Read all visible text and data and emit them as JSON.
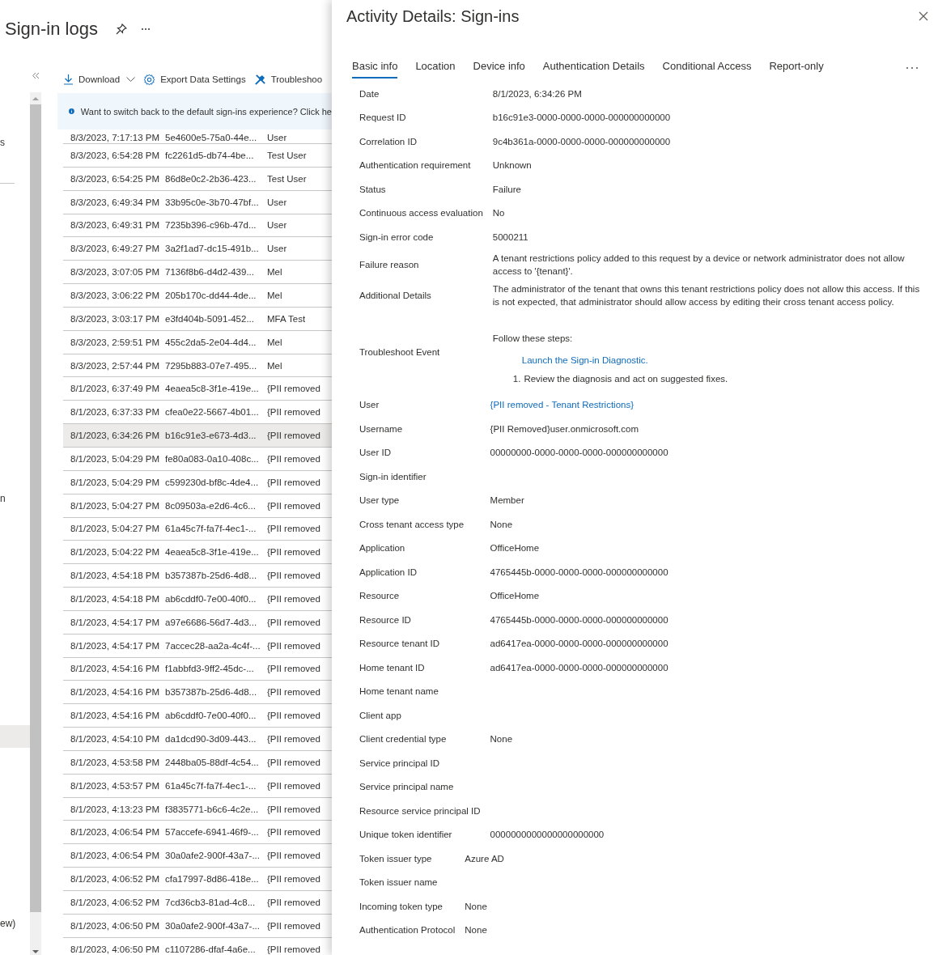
{
  "blade": {
    "title": "Sign-in logs"
  },
  "sidebar": {
    "items": [
      {
        "label": "s",
        "selected": false
      },
      {
        "label": "n",
        "selected": false
      },
      {
        "selected": true
      },
      {
        "label": "ew)",
        "selected": false
      }
    ]
  },
  "toolbar": [
    {
      "kind": "download",
      "label": "Download"
    },
    {
      "kind": "settings",
      "label": "Export Data Settings"
    },
    {
      "kind": "troubleshoot",
      "label": "Troubleshoo"
    }
  ],
  "banner": {
    "text": "Want to switch back to the default sign-ins experience? Click he"
  },
  "table": {
    "rows": [
      {
        "date": "8/3/2023, 7:17:13 PM",
        "request_id": "5e4600e5-75a0-44e...",
        "user": "User",
        "selected": false
      },
      {
        "date": "8/3/2023, 6:54:28 PM",
        "request_id": "fc2261d5-db74-4be...",
        "user": "Test User",
        "selected": false
      },
      {
        "date": "8/3/2023, 6:54:25 PM",
        "request_id": "86d8e0c2-2b36-423...",
        "user": "Test User",
        "selected": false
      },
      {
        "date": "8/3/2023, 6:49:34 PM",
        "request_id": "33b95c0e-3b70-47bf...",
        "user": "User",
        "selected": false
      },
      {
        "date": "8/3/2023, 6:49:31 PM",
        "request_id": "7235b396-c96b-47d...",
        "user": "User",
        "selected": false
      },
      {
        "date": "8/3/2023, 6:49:27 PM",
        "request_id": "3a2f1ad7-dc15-491b...",
        "user": "User",
        "selected": false
      },
      {
        "date": "8/3/2023, 3:07:05 PM",
        "request_id": "7136f8b6-d4d2-439...",
        "user": "Mel",
        "selected": false
      },
      {
        "date": "8/3/2023, 3:06:22 PM",
        "request_id": "205b170c-dd44-4de...",
        "user": "Mel",
        "selected": false
      },
      {
        "date": "8/3/2023, 3:03:17 PM",
        "request_id": "e3fd404b-5091-452...",
        "user": "MFA Test",
        "selected": false
      },
      {
        "date": "8/3/2023, 2:59:51 PM",
        "request_id": "455c2da5-2e04-4d4...",
        "user": "Mel",
        "selected": false
      },
      {
        "date": "8/3/2023, 2:57:44 PM",
        "request_id": "7295b883-07e7-495...",
        "user": "Mel",
        "selected": false
      },
      {
        "date": "8/1/2023, 6:37:49 PM",
        "request_id": "4eaea5c8-3f1e-419e...",
        "user": "{PII removed",
        "selected": false
      },
      {
        "date": "8/1/2023, 6:37:33 PM",
        "request_id": "cfea0e22-5667-4b01...",
        "user": "{PII removed",
        "selected": false
      },
      {
        "date": "8/1/2023, 6:34:26 PM",
        "request_id": "b16c91e3-e673-4d3...",
        "user": "{PII removed",
        "selected": true
      },
      {
        "date": "8/1/2023, 5:04:29 PM",
        "request_id": "fe80a083-0a10-408c...",
        "user": "{PII removed",
        "selected": false
      },
      {
        "date": "8/1/2023, 5:04:29 PM",
        "request_id": "c599230d-bf8c-4de4...",
        "user": "{PII removed",
        "selected": false
      },
      {
        "date": "8/1/2023, 5:04:27 PM",
        "request_id": "8c09503a-e2d6-4c6...",
        "user": "{PII removed",
        "selected": false
      },
      {
        "date": "8/1/2023, 5:04:27 PM",
        "request_id": "61a45c7f-fa7f-4ec1-...",
        "user": "{PII removed",
        "selected": false
      },
      {
        "date": "8/1/2023, 5:04:22 PM",
        "request_id": "4eaea5c8-3f1e-419e...",
        "user": "{PII removed",
        "selected": false
      },
      {
        "date": "8/1/2023, 4:54:18 PM",
        "request_id": "b357387b-25d6-4d8...",
        "user": "{PII removed",
        "selected": false
      },
      {
        "date": "8/1/2023, 4:54:18 PM",
        "request_id": "ab6cddf0-7e00-40f0...",
        "user": "{PII removed",
        "selected": false
      },
      {
        "date": "8/1/2023, 4:54:17 PM",
        "request_id": "a97e6686-56d7-4d3...",
        "user": "{PII removed",
        "selected": false
      },
      {
        "date": "8/1/2023, 4:54:17 PM",
        "request_id": "7accec28-aa2a-4c4f-...",
        "user": "{PII removed",
        "selected": false
      },
      {
        "date": "8/1/2023, 4:54:16 PM",
        "request_id": "f1abbfd3-9ff2-45dc-...",
        "user": "{PII removed",
        "selected": false
      },
      {
        "date": "8/1/2023, 4:54:16 PM",
        "request_id": "b357387b-25d6-4d8...",
        "user": "{PII removed",
        "selected": false
      },
      {
        "date": "8/1/2023, 4:54:16 PM",
        "request_id": "ab6cddf0-7e00-40f0...",
        "user": "{PII removed",
        "selected": false
      },
      {
        "date": "8/1/2023, 4:54:10 PM",
        "request_id": "da1dcd90-3d09-443...",
        "user": "{PII removed",
        "selected": false
      },
      {
        "date": "8/1/2023, 4:53:58 PM",
        "request_id": "2448ba05-88df-4c54...",
        "user": "{PII removed",
        "selected": false
      },
      {
        "date": "8/1/2023, 4:53:57 PM",
        "request_id": "61a45c7f-fa7f-4ec1-...",
        "user": "{PII removed",
        "selected": false
      },
      {
        "date": "8/1/2023, 4:13:23 PM",
        "request_id": "f3835771-b6c6-4c2e...",
        "user": "{PII removed",
        "selected": false
      },
      {
        "date": "8/1/2023, 4:06:54 PM",
        "request_id": "57accefe-6941-46f9-...",
        "user": "{PII removed",
        "selected": false
      },
      {
        "date": "8/1/2023, 4:06:54 PM",
        "request_id": "30a0afe2-900f-43a7-...",
        "user": "{PII removed",
        "selected": false
      },
      {
        "date": "8/1/2023, 4:06:52 PM",
        "request_id": "cfa17997-8d86-418e...",
        "user": "{PII removed",
        "selected": false
      },
      {
        "date": "8/1/2023, 4:06:52 PM",
        "request_id": "7cd36cb3-81ad-4c8...",
        "user": "{PII removed",
        "selected": false
      },
      {
        "date": "8/1/2023, 4:06:50 PM",
        "request_id": "30a0afe2-900f-43a7-...",
        "user": "{PII removed",
        "selected": false
      },
      {
        "date": "8/1/2023, 4:06:50 PM",
        "request_id": "c1107286-dfaf-4a6e...",
        "user": "{PII removed",
        "selected": false
      }
    ]
  },
  "details_panel": {
    "title": "Activity Details: Sign-ins",
    "tabs": [
      {
        "label": "Basic info",
        "selected": true
      },
      {
        "label": "Location",
        "selected": false
      },
      {
        "label": "Device info",
        "selected": false
      },
      {
        "label": "Authentication Details",
        "selected": false
      },
      {
        "label": "Conditional Access",
        "selected": false
      },
      {
        "label": "Report-only",
        "selected": false
      }
    ],
    "sections": [
      [
        {
          "kind": "text",
          "label": "Date",
          "value": "8/1/2023, 6:34:26 PM"
        },
        {
          "kind": "text",
          "label": "Request ID",
          "value": "b16c91e3-0000-0000-0000-000000000000"
        },
        {
          "kind": "text",
          "label": "Correlation ID",
          "value": "9c4b361a-0000-0000-0000-000000000000"
        },
        {
          "kind": "text",
          "label": "Authentication requirement",
          "value": "Unknown"
        },
        {
          "kind": "text",
          "label": "Status",
          "value": "Failure"
        },
        {
          "kind": "text",
          "label": "Continuous access evaluation",
          "value": "No"
        },
        {
          "kind": "text",
          "label": "Sign-in error code",
          "value": "5000211"
        },
        {
          "kind": "text",
          "label": "Failure reason",
          "value": "A tenant restrictions policy added to this request by a device or network administrator does not allow access to '{tenant}'."
        },
        {
          "kind": "text",
          "label": "Additional Details",
          "value": "The administrator of the tenant that owns this tenant restrictions policy does not allow this access. If this is not expected, that administrator should allow access by editing their cross tenant access policy."
        },
        {
          "kind": "troubleshoot",
          "label": "Troubleshoot Event",
          "intro": "Follow these steps:",
          "link": "Launch the Sign-in Diagnostic.",
          "steps": [
            {
              "number": "1.",
              "text": "Review the diagnosis and act on suggested fixes."
            }
          ]
        }
      ],
      [
        {
          "kind": "link",
          "label": "User",
          "value": "{PII removed - Tenant Restrictions}"
        },
        {
          "kind": "text",
          "label": "Username",
          "value": "{PII Removed}user.onmicrosoft.com"
        },
        {
          "kind": "text",
          "label": "User ID",
          "value": "00000000-0000-0000-0000-000000000000"
        },
        {
          "kind": "text",
          "label": "Sign-in identifier"
        },
        {
          "kind": "text",
          "label": "User type",
          "value": "Member"
        },
        {
          "kind": "text",
          "label": "Cross tenant access type",
          "value": "None"
        },
        {
          "kind": "text",
          "label": "Application",
          "value": "OfficeHome"
        },
        {
          "kind": "text",
          "label": "Application ID",
          "value": "4765445b-0000-0000-0000-000000000000"
        },
        {
          "kind": "text",
          "label": "Resource",
          "value": "OfficeHome"
        },
        {
          "kind": "text",
          "label": "Resource ID",
          "value": "4765445b-0000-0000-0000-000000000000"
        },
        {
          "kind": "text",
          "label": "Resource tenant ID",
          "value": "ad6417ea-0000-0000-0000-000000000000"
        },
        {
          "kind": "text",
          "label": "Home tenant ID",
          "value": "ad6417ea-0000-0000-0000-000000000000"
        },
        {
          "kind": "text",
          "label": "Home tenant name"
        },
        {
          "kind": "text",
          "label": "Client app"
        },
        {
          "kind": "text",
          "label": "Client credential type",
          "value": "None"
        },
        {
          "kind": "text",
          "label": "Service principal ID"
        },
        {
          "kind": "text",
          "label": "Service principal name"
        },
        {
          "kind": "text",
          "label": "Resource service principal ID"
        },
        {
          "kind": "text",
          "label": "Unique token identifier",
          "value": "0000000000000000000000"
        }
      ],
      [
        {
          "kind": "text",
          "label": "Token issuer type",
          "value": "Azure AD"
        },
        {
          "kind": "text",
          "label": "Token issuer name"
        },
        {
          "kind": "text",
          "label": "Incoming token type",
          "value": "None"
        },
        {
          "kind": "text",
          "label": "Authentication Protocol",
          "value": "None"
        }
      ]
    ]
  }
}
